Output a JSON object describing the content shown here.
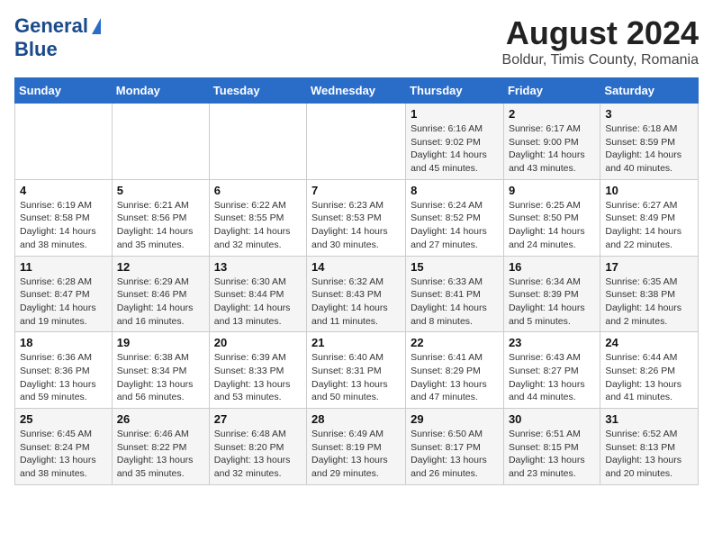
{
  "header": {
    "logo_line1": "General",
    "logo_line2": "Blue",
    "month": "August 2024",
    "location": "Boldur, Timis County, Romania"
  },
  "weekdays": [
    "Sunday",
    "Monday",
    "Tuesday",
    "Wednesday",
    "Thursday",
    "Friday",
    "Saturday"
  ],
  "weeks": [
    [
      {
        "day": "",
        "detail": ""
      },
      {
        "day": "",
        "detail": ""
      },
      {
        "day": "",
        "detail": ""
      },
      {
        "day": "",
        "detail": ""
      },
      {
        "day": "1",
        "detail": "Sunrise: 6:16 AM\nSunset: 9:02 PM\nDaylight: 14 hours\nand 45 minutes."
      },
      {
        "day": "2",
        "detail": "Sunrise: 6:17 AM\nSunset: 9:00 PM\nDaylight: 14 hours\nand 43 minutes."
      },
      {
        "day": "3",
        "detail": "Sunrise: 6:18 AM\nSunset: 8:59 PM\nDaylight: 14 hours\nand 40 minutes."
      }
    ],
    [
      {
        "day": "4",
        "detail": "Sunrise: 6:19 AM\nSunset: 8:58 PM\nDaylight: 14 hours\nand 38 minutes."
      },
      {
        "day": "5",
        "detail": "Sunrise: 6:21 AM\nSunset: 8:56 PM\nDaylight: 14 hours\nand 35 minutes."
      },
      {
        "day": "6",
        "detail": "Sunrise: 6:22 AM\nSunset: 8:55 PM\nDaylight: 14 hours\nand 32 minutes."
      },
      {
        "day": "7",
        "detail": "Sunrise: 6:23 AM\nSunset: 8:53 PM\nDaylight: 14 hours\nand 30 minutes."
      },
      {
        "day": "8",
        "detail": "Sunrise: 6:24 AM\nSunset: 8:52 PM\nDaylight: 14 hours\nand 27 minutes."
      },
      {
        "day": "9",
        "detail": "Sunrise: 6:25 AM\nSunset: 8:50 PM\nDaylight: 14 hours\nand 24 minutes."
      },
      {
        "day": "10",
        "detail": "Sunrise: 6:27 AM\nSunset: 8:49 PM\nDaylight: 14 hours\nand 22 minutes."
      }
    ],
    [
      {
        "day": "11",
        "detail": "Sunrise: 6:28 AM\nSunset: 8:47 PM\nDaylight: 14 hours\nand 19 minutes."
      },
      {
        "day": "12",
        "detail": "Sunrise: 6:29 AM\nSunset: 8:46 PM\nDaylight: 14 hours\nand 16 minutes."
      },
      {
        "day": "13",
        "detail": "Sunrise: 6:30 AM\nSunset: 8:44 PM\nDaylight: 14 hours\nand 13 minutes."
      },
      {
        "day": "14",
        "detail": "Sunrise: 6:32 AM\nSunset: 8:43 PM\nDaylight: 14 hours\nand 11 minutes."
      },
      {
        "day": "15",
        "detail": "Sunrise: 6:33 AM\nSunset: 8:41 PM\nDaylight: 14 hours\nand 8 minutes."
      },
      {
        "day": "16",
        "detail": "Sunrise: 6:34 AM\nSunset: 8:39 PM\nDaylight: 14 hours\nand 5 minutes."
      },
      {
        "day": "17",
        "detail": "Sunrise: 6:35 AM\nSunset: 8:38 PM\nDaylight: 14 hours\nand 2 minutes."
      }
    ],
    [
      {
        "day": "18",
        "detail": "Sunrise: 6:36 AM\nSunset: 8:36 PM\nDaylight: 13 hours\nand 59 minutes."
      },
      {
        "day": "19",
        "detail": "Sunrise: 6:38 AM\nSunset: 8:34 PM\nDaylight: 13 hours\nand 56 minutes."
      },
      {
        "day": "20",
        "detail": "Sunrise: 6:39 AM\nSunset: 8:33 PM\nDaylight: 13 hours\nand 53 minutes."
      },
      {
        "day": "21",
        "detail": "Sunrise: 6:40 AM\nSunset: 8:31 PM\nDaylight: 13 hours\nand 50 minutes."
      },
      {
        "day": "22",
        "detail": "Sunrise: 6:41 AM\nSunset: 8:29 PM\nDaylight: 13 hours\nand 47 minutes."
      },
      {
        "day": "23",
        "detail": "Sunrise: 6:43 AM\nSunset: 8:27 PM\nDaylight: 13 hours\nand 44 minutes."
      },
      {
        "day": "24",
        "detail": "Sunrise: 6:44 AM\nSunset: 8:26 PM\nDaylight: 13 hours\nand 41 minutes."
      }
    ],
    [
      {
        "day": "25",
        "detail": "Sunrise: 6:45 AM\nSunset: 8:24 PM\nDaylight: 13 hours\nand 38 minutes."
      },
      {
        "day": "26",
        "detail": "Sunrise: 6:46 AM\nSunset: 8:22 PM\nDaylight: 13 hours\nand 35 minutes."
      },
      {
        "day": "27",
        "detail": "Sunrise: 6:48 AM\nSunset: 8:20 PM\nDaylight: 13 hours\nand 32 minutes."
      },
      {
        "day": "28",
        "detail": "Sunrise: 6:49 AM\nSunset: 8:19 PM\nDaylight: 13 hours\nand 29 minutes."
      },
      {
        "day": "29",
        "detail": "Sunrise: 6:50 AM\nSunset: 8:17 PM\nDaylight: 13 hours\nand 26 minutes."
      },
      {
        "day": "30",
        "detail": "Sunrise: 6:51 AM\nSunset: 8:15 PM\nDaylight: 13 hours\nand 23 minutes."
      },
      {
        "day": "31",
        "detail": "Sunrise: 6:52 AM\nSunset: 8:13 PM\nDaylight: 13 hours\nand 20 minutes."
      }
    ]
  ]
}
